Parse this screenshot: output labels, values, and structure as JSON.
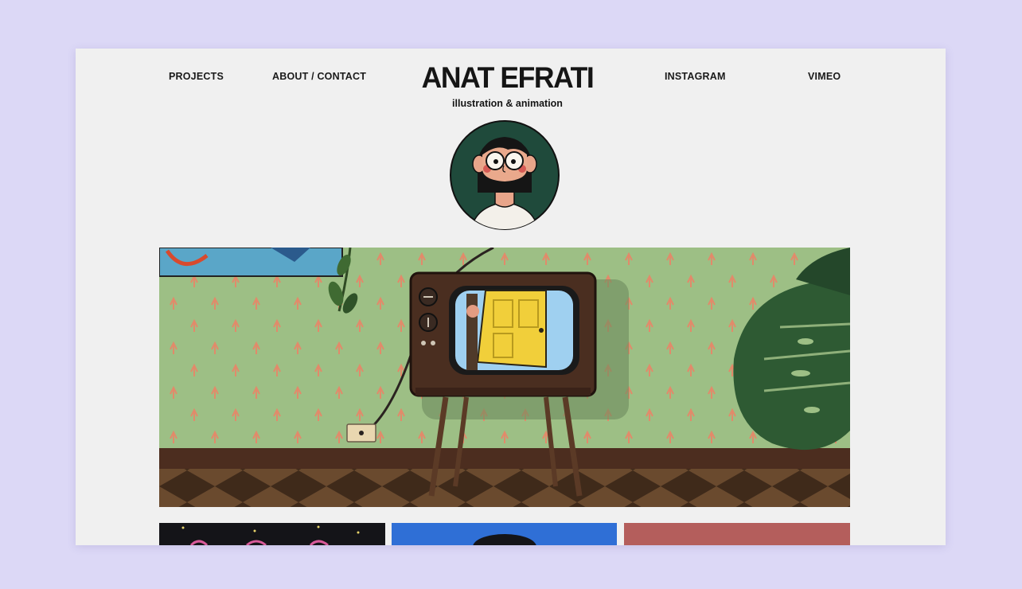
{
  "nav": {
    "projects": "PROJECTS",
    "about_contact": "ABOUT / CONTACT",
    "instagram": "INSTAGRAM",
    "vimeo": "VIMEO"
  },
  "brand": {
    "title": "ANAT EFRATI",
    "subtitle": "illustration & animation"
  },
  "colors": {
    "outer_background": "#dcd8f6",
    "page_background": "#f0f0f0",
    "avatar_circle": "#1f4a3b",
    "wall_green": "#9dbf85",
    "tv_wood": "#4a2e20",
    "thumb_dark": "#141418",
    "thumb_blue": "#2f6fd6",
    "thumb_rose": "#b45e5c"
  },
  "icons": {
    "avatar": "illustrated-portrait-woman-glasses",
    "hero": "animated-retro-tv-room-illustration"
  }
}
